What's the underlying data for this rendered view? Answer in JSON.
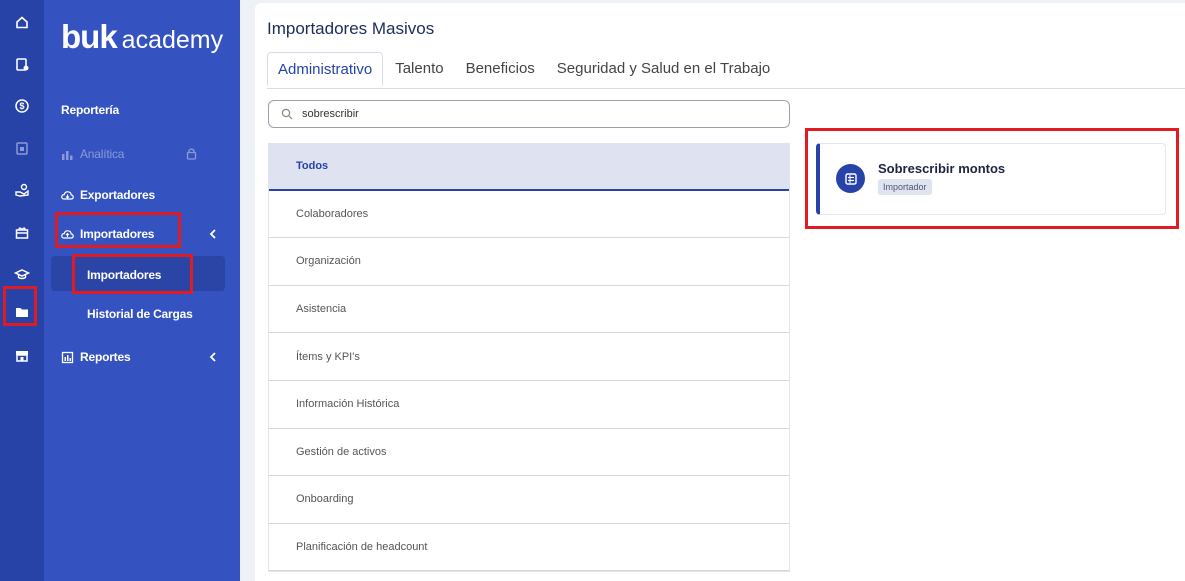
{
  "rail": {
    "icons": [
      "home-icon",
      "clipboard-icon",
      "dollar-icon",
      "lock-doc-icon",
      "hand-icon",
      "gift-icon",
      "graduation-cap-icon",
      "folder-icon",
      "store-icon"
    ]
  },
  "nav": {
    "logo_primary": "buk",
    "logo_secondary": "academy",
    "section_title": "Reportería",
    "items": [
      {
        "label": "Analítica",
        "icon": "chart-icon"
      },
      {
        "label": "Exportadores",
        "icon": "cloud-download-icon"
      },
      {
        "label": "Importadores",
        "icon": "cloud-upload-icon"
      },
      {
        "label": "Reportes",
        "icon": "report-icon"
      }
    ],
    "subitems": [
      {
        "label": "Importadores"
      },
      {
        "label": "Historial de Cargas"
      }
    ]
  },
  "main": {
    "title": "Importadores Masivos",
    "tabs": [
      "Administrativo",
      "Talento",
      "Beneficios",
      "Seguridad y Salud en el Trabajo"
    ],
    "search": {
      "value": "sobrescribir"
    },
    "categories": [
      "Todos",
      "Colaboradores",
      "Organización",
      "Asistencia",
      "Ítems y KPI's",
      "Información Histórica",
      "Gestión de activos",
      "Onboarding",
      "Planificación de headcount"
    ],
    "result": {
      "title": "Sobrescribir montos",
      "badge": "Importador"
    }
  },
  "colors": {
    "brand": "#3452c0",
    "rail": "#2743a8",
    "highlight": "#e11b22"
  }
}
